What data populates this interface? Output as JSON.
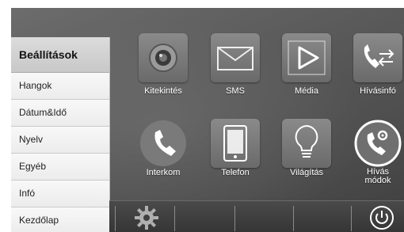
{
  "sidebar": {
    "title": "Beállítások",
    "items": [
      "Hangok",
      "Dátum&Idő",
      "Nyelv",
      "Egyéb",
      "Infó",
      "Kezdőlap"
    ]
  },
  "apps": {
    "kitekintes": "Kitekintés",
    "sms": "SMS",
    "media": "Média",
    "hivasinfo": "Hívásinfó",
    "interkom": "Interkom",
    "telefon": "Telefon",
    "vilagitas": "Világítás",
    "hivas_modok_1": "Hívás",
    "hivas_modok_2": "módok"
  },
  "icons": {
    "camera": "camera-icon",
    "envelope": "envelope-icon",
    "play": "play-icon",
    "call_transfer": "call-transfer-icon",
    "phone": "phone-icon",
    "tablet": "tablet-icon",
    "bulb": "light-bulb-icon",
    "phone_gear": "phone-settings-icon",
    "gear": "gear-icon",
    "power": "power-icon"
  }
}
